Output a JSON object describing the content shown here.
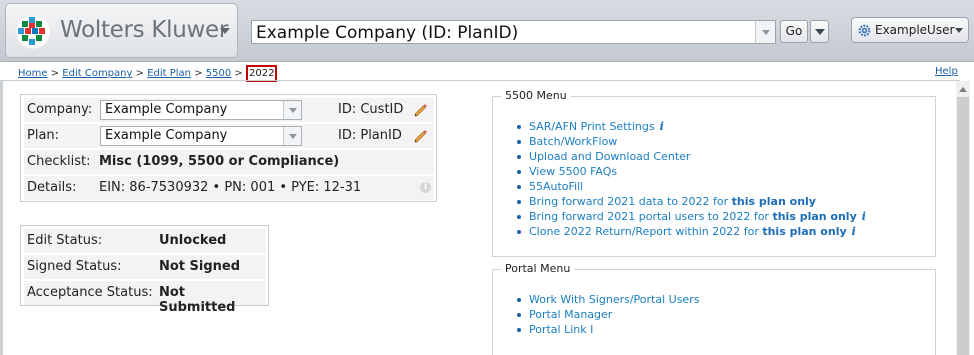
{
  "header": {
    "brand": "Wolters Kluwer",
    "company_selector_value": "Example Company (ID: PlanID)",
    "go_label": "Go",
    "user_label": "ExampleUser"
  },
  "breadcrumb": {
    "items": [
      "Home",
      "Edit Company",
      "Edit Plan",
      "5500"
    ],
    "separator": ">",
    "current": "2022"
  },
  "help_label": "Help",
  "plan_info": {
    "company_label": "Company:",
    "company_value": "Example Company",
    "company_id": "ID: CustID",
    "plan_label": "Plan:",
    "plan_value": "Example Company",
    "plan_id": "ID: PlanID",
    "checklist_label": "Checklist:",
    "checklist_value": "Misc (1099, 5500 or Compliance)",
    "details_label": "Details:",
    "details_value": "EIN: 86-7530932 • PN: 001 • PYE: 12-31"
  },
  "status": {
    "edit_label": "Edit Status:",
    "edit_value": "Unlocked",
    "signed_label": "Signed Status:",
    "signed_value": "Not Signed",
    "acceptance_label": "Acceptance Status:",
    "acceptance_value": "Not Submitted"
  },
  "menu_5500": {
    "title": "5500 Menu",
    "items": {
      "sar_afn": "SAR/AFN Print Settings",
      "batch": "Batch/WorkFlow",
      "upload": "Upload and Download Center",
      "faqs": "View 5500 FAQs",
      "autofill": "55AutoFill",
      "bring_data_pre": "Bring forward 2021 data to 2022 for ",
      "bring_data_bold": "this plan only",
      "bring_users_pre": "Bring forward 2021 portal users to 2022 for ",
      "bring_users_bold": "this plan only",
      "clone_pre": "Clone 2022 Return/Report within 2022 for ",
      "clone_bold": "this plan only"
    },
    "info_glyph": "i"
  },
  "portal_menu": {
    "title": "Portal Menu",
    "items": [
      "Work With Signers/Portal Users",
      "Portal Manager",
      "Portal Link I"
    ]
  }
}
